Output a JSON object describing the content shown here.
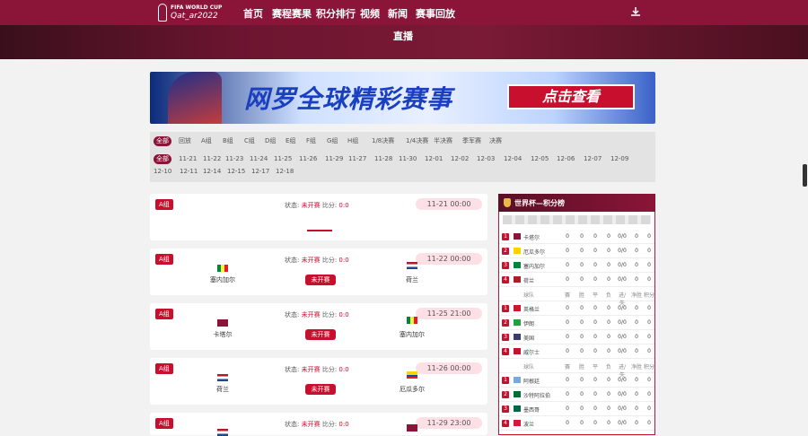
{
  "logo": {
    "line1": "FIFA WORLD CUP",
    "line2": "Qat_ar2022"
  },
  "nav": [
    "首页",
    "赛程赛果",
    "积分排行",
    "视频",
    "新闻",
    "赛事回放"
  ],
  "hero": {
    "live": "直播"
  },
  "banner": {
    "headline": "网罗全球精彩赛事",
    "button": "点击查看"
  },
  "filters": {
    "stages": [
      "全部",
      "回放",
      "A组",
      "B组",
      "C组",
      "D组",
      "E组",
      "F组",
      "G组",
      "H组",
      "1/8决赛",
      "1/4决赛",
      "半决赛",
      "季军赛",
      "决赛"
    ],
    "dates": [
      "全部",
      "11-21",
      "11-22",
      "11-23",
      "11-24",
      "11-25",
      "11-26",
      "11-29",
      "11-27",
      "11-28",
      "11-30",
      "12-01",
      "12-02",
      "12-03",
      "12-04",
      "12-05",
      "12-06",
      "12-07",
      "12-09",
      "12-10",
      "12-11",
      "12-14",
      "12-15",
      "12-17",
      "12-18"
    ]
  },
  "match_labels": {
    "status": "状态:",
    "status_value": "未开赛",
    "score": "比分:",
    "score_value": "0:0",
    "not_started": "未开赛"
  },
  "matches": [
    {
      "group": "A组",
      "time": "11-21 00:00",
      "home": "",
      "away": ""
    },
    {
      "group": "A组",
      "time": "11-22 00:00",
      "home": "塞内加尔",
      "away": "荷兰"
    },
    {
      "group": "A组",
      "time": "11-25 21:00",
      "home": "卡塔尔",
      "away": "塞内加尔"
    },
    {
      "group": "A组",
      "time": "11-26 00:00",
      "home": "荷兰",
      "away": "厄瓜多尔"
    },
    {
      "group": "A组",
      "time": "11-29 23:00",
      "home": "",
      "away": ""
    }
  ],
  "ranking": {
    "title": "世界杯—积分榜",
    "header": [
      "球队",
      "赛",
      "胜",
      "平",
      "负",
      "进/失",
      "净胜",
      "积分"
    ],
    "groupA": [
      {
        "n": "1",
        "team": "卡塔尔",
        "vals": [
          "0",
          "0",
          "0",
          "0",
          "0/0",
          "0",
          "0"
        ]
      },
      {
        "n": "2",
        "team": "厄瓜多尔",
        "vals": [
          "0",
          "0",
          "0",
          "0",
          "0/0",
          "0",
          "0"
        ]
      },
      {
        "n": "3",
        "team": "塞内加尔",
        "vals": [
          "0",
          "0",
          "0",
          "0",
          "0/0",
          "0",
          "0"
        ]
      },
      {
        "n": "4",
        "team": "荷兰",
        "vals": [
          "0",
          "0",
          "0",
          "0",
          "0/0",
          "0",
          "0"
        ]
      }
    ],
    "groupB": [
      {
        "n": "1",
        "team": "英格兰",
        "vals": [
          "0",
          "0",
          "0",
          "0",
          "0/0",
          "0",
          "0"
        ]
      },
      {
        "n": "2",
        "team": "伊朗",
        "vals": [
          "0",
          "0",
          "0",
          "0",
          "0/0",
          "0",
          "0"
        ]
      },
      {
        "n": "3",
        "team": "美国",
        "vals": [
          "0",
          "0",
          "0",
          "0",
          "0/0",
          "0",
          "0"
        ]
      },
      {
        "n": "4",
        "team": "威尔士",
        "vals": [
          "0",
          "0",
          "0",
          "0",
          "0/0",
          "0",
          "0"
        ]
      }
    ],
    "groupC": [
      {
        "n": "1",
        "team": "阿根廷",
        "vals": [
          "0",
          "0",
          "0",
          "0",
          "0/0",
          "0",
          "0"
        ]
      },
      {
        "n": "2",
        "team": "沙特阿拉伯",
        "vals": [
          "0",
          "0",
          "0",
          "0",
          "0/0",
          "0",
          "0"
        ]
      },
      {
        "n": "3",
        "team": "墨西哥",
        "vals": [
          "0",
          "0",
          "0",
          "0",
          "0/0",
          "0",
          "0"
        ]
      },
      {
        "n": "4",
        "team": "波兰",
        "vals": [
          "0",
          "0",
          "0",
          "0",
          "0/0",
          "0",
          "0"
        ]
      }
    ]
  }
}
